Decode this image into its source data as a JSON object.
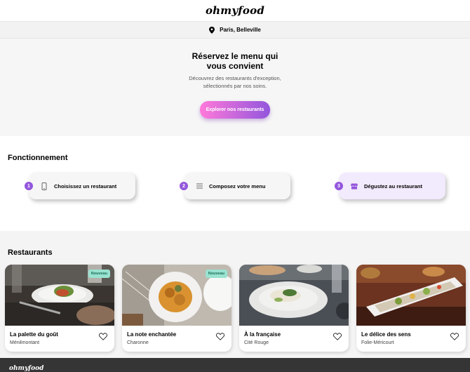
{
  "header": {
    "logo": "ohmyfood"
  },
  "location": {
    "icon": "map-pin-icon",
    "text": "Paris, Belleville"
  },
  "hero": {
    "title": "Réservez le menu qui vous convient",
    "subtitle": "Découvrez des restaurants d'exception, sélectionnés par nos soins.",
    "cta_label": "Explorer nos restaurants"
  },
  "how": {
    "title": "Fonctionnement",
    "steps": [
      {
        "number": "1",
        "icon": "phone-icon",
        "label": "Choisissez un restaurant"
      },
      {
        "number": "2",
        "icon": "list-icon",
        "label": "Composez votre menu"
      },
      {
        "number": "3",
        "icon": "store-icon",
        "label": "Dégustez au restaurant"
      }
    ]
  },
  "restaurants": {
    "title": "Restaurants",
    "items": [
      {
        "name": "La palette du goût",
        "area": "Ménilmontant",
        "badge": "Nouveau"
      },
      {
        "name": "La note enchantée",
        "area": "Charonne",
        "badge": "Nouveau"
      },
      {
        "name": "À la française",
        "area": "Cité Rouge",
        "badge": ""
      },
      {
        "name": "Le délice des sens",
        "area": "Folie-Méricourt",
        "badge": ""
      }
    ]
  },
  "footer": {
    "logo": "ohmyfood"
  },
  "colors": {
    "accent_start": "#ff79da",
    "accent_end": "#9356dc",
    "badge_bg": "#99e2d0",
    "footer_bg": "#353535"
  }
}
